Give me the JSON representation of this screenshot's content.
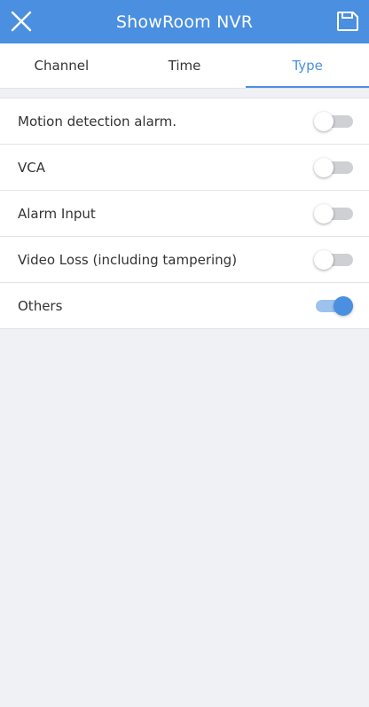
{
  "header": {
    "title": "ShowRoom NVR",
    "close_icon": "close-icon",
    "save_icon": "save-icon",
    "background": "#4a8fe0"
  },
  "tabs": [
    {
      "label": "Channel",
      "active": false
    },
    {
      "label": "Time",
      "active": false
    },
    {
      "label": "Type",
      "active": true
    }
  ],
  "alarm_types": [
    {
      "label": "Motion detection alarm.",
      "enabled": false
    },
    {
      "label": "VCA",
      "enabled": false
    },
    {
      "label": "Alarm Input",
      "enabled": false
    },
    {
      "label": "Video Loss (including tampering)",
      "enabled": false
    },
    {
      "label": "Others",
      "enabled": true
    }
  ],
  "colors": {
    "accent": "#4a8fe0",
    "toggle_on_track": "#9dc2ee",
    "toggle_off_track": "#cfd0d4",
    "page_background": "#f0f1f5"
  }
}
